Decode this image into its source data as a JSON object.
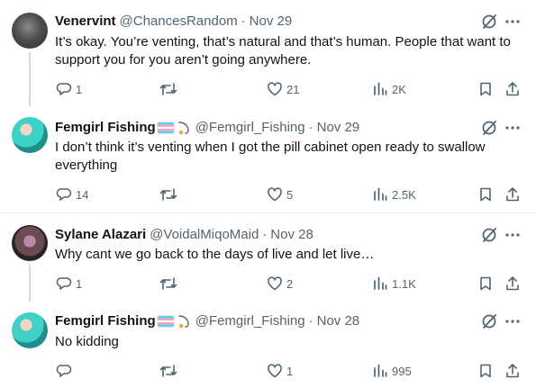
{
  "tweets": [
    {
      "name": "Venervint",
      "handle": "@ChancesRandom",
      "separator": "·",
      "date": "Nov 29",
      "text": "It’s okay. You’re venting, that’s natural and that’s human. People that want to support you for you aren’t going anywhere.",
      "replies": "1",
      "retweets": "",
      "likes": "21",
      "views": "2K",
      "avatar": "grey-cat-avatar"
    },
    {
      "name": "Femgirl Fishing",
      "handle": "@Femgirl_Fishing",
      "separator": "·",
      "date": "Nov 29",
      "text": "I don’t think it’s venting when I got the pill cabinet open ready to swallow everything",
      "replies": "14",
      "retweets": "",
      "likes": "5",
      "views": "2.5K",
      "avatar": "teal-hair-avatar"
    },
    {
      "name": "Sylane Alazari",
      "handle": "@VoidalMiqoMaid",
      "separator": "·",
      "date": "Nov 28",
      "text": "Why cant we go back to the days of live and let live…",
      "replies": "1",
      "retweets": "",
      "likes": "2",
      "views": "1.1K",
      "avatar": "dark-character-avatar"
    },
    {
      "name": "Femgirl Fishing",
      "handle": "@Femgirl_Fishing",
      "separator": "·",
      "date": "Nov 28",
      "text": "No kidding",
      "replies": "",
      "retweets": "",
      "likes": "1",
      "views": "995",
      "avatar": "teal-hair-avatar"
    }
  ],
  "colors": {
    "text": "#0f1419",
    "secondary": "#536471",
    "thread_line": "#cfd9de",
    "divider": "#eff3f4"
  },
  "icons": [
    "grok-icon",
    "more-icon",
    "reply-icon",
    "retweet-icon",
    "like-icon",
    "views-icon",
    "bookmark-icon",
    "share-icon",
    "trans-flag-icon",
    "fishing-icon"
  ]
}
